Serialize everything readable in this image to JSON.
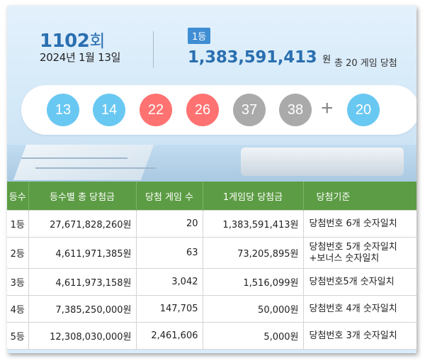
{
  "draw": {
    "round_number": "1102",
    "round_unit": "회",
    "date": "2024년 1월 13일"
  },
  "first_prize": {
    "badge": "1등",
    "amount": "1,383,591,413",
    "amount_unit": "원",
    "winners_text": "총 20 게임 당첨"
  },
  "balls": [
    {
      "number": "13",
      "color": "#69c8f2"
    },
    {
      "number": "14",
      "color": "#69c8f2"
    },
    {
      "number": "22",
      "color": "#ff7272"
    },
    {
      "number": "26",
      "color": "#ff7272"
    },
    {
      "number": "37",
      "color": "#aaaaaa"
    },
    {
      "number": "38",
      "color": "#aaaaaa"
    }
  ],
  "plus_sign": "+",
  "bonus_ball": {
    "number": "20",
    "color": "#69c8f2"
  },
  "table": {
    "headers": [
      "등수",
      "등수별 총 당첨금",
      "당첨 게임 수",
      "1게임당 당첨금",
      "당첨기준"
    ],
    "rows": [
      {
        "rank": "1등",
        "total": "27,671,828,260원",
        "games": "20",
        "per_game": "1,383,591,413원",
        "criteria": [
          "당첨번호 6개 숫자일치"
        ]
      },
      {
        "rank": "2등",
        "total": "4,611,971,385원",
        "games": "63",
        "per_game": "73,205,895원",
        "criteria": [
          "당첨번호 5개 숫자일치",
          "+보너스 숫자일치"
        ]
      },
      {
        "rank": "3등",
        "total": "4,611,973,158원",
        "games": "3,042",
        "per_game": "1,516,099원",
        "criteria": [
          "당첨번호5개 숫자일치"
        ]
      },
      {
        "rank": "4등",
        "total": "7,385,250,000원",
        "games": "147,705",
        "per_game": "50,000원",
        "criteria": [
          "당첨번호 4개 숫자일치"
        ]
      },
      {
        "rank": "5등",
        "total": "12,308,030,000원",
        "games": "2,461,606",
        "per_game": "5,000원",
        "criteria": [
          "당첨번호 3개 숫자일치"
        ]
      }
    ]
  },
  "colors": {
    "header_green": "#5c9c44",
    "accent_blue": "#2a6fb0",
    "ball_blue": "#69c8f2",
    "ball_red": "#ff7272",
    "ball_gray": "#aaaaaa"
  }
}
